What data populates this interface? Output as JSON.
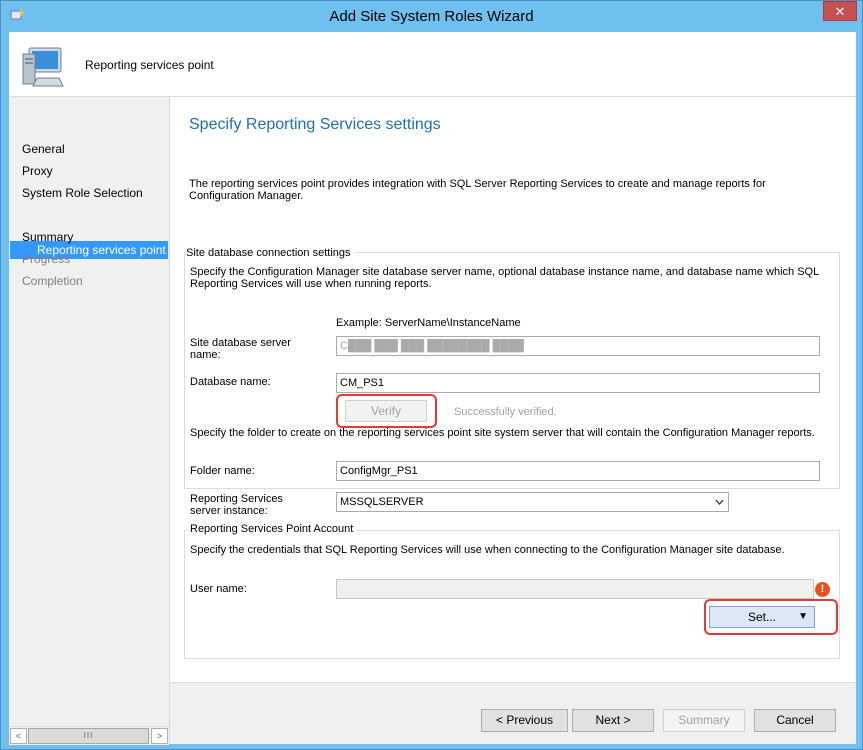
{
  "window": {
    "title": "Add Site System Roles Wizard",
    "close_glyph": "✕"
  },
  "header": {
    "title": "Reporting services point"
  },
  "nav": {
    "items": [
      {
        "label": "General"
      },
      {
        "label": "Proxy"
      },
      {
        "label": "System Role Selection"
      },
      {
        "label": "Reporting services point"
      },
      {
        "label": "Summary"
      },
      {
        "label": "Progress"
      },
      {
        "label": "Completion"
      }
    ],
    "scroll_left": "<",
    "scroll_right": ">",
    "scroll_grip": "III"
  },
  "page": {
    "heading": "Specify Reporting Services settings",
    "intro": "The reporting services point provides integration with SQL Server Reporting Services to create and manage reports for Configuration Manager.",
    "db_group": {
      "title": "Site database connection settings",
      "description": "Specify the Configuration Manager site database server name, optional database instance name, and database name which SQL Reporting Services will use when running reports.",
      "example": "Example: ServerName\\InstanceName",
      "server_label": "Site database server name:",
      "server_value": "C███ ███ ███ ████████ ████",
      "dbname_label": "Database name:",
      "dbname_value": "CM_PS1",
      "verify_label": "Verify",
      "verify_status": "Successfully verified.",
      "folder_desc": "Specify the folder to create on the reporting services point site system server that will contain the Configuration Manager reports.",
      "folder_label": "Folder name:",
      "folder_value": "ConfigMgr_PS1"
    },
    "instance_label": "Reporting Services server instance:",
    "instance_value": "MSSQLSERVER",
    "account_group": {
      "title": "Reporting Services Point Account",
      "description": "Specify the credentials that SQL Reporting Services will use when connecting to the Configuration Manager site database.",
      "username_label": "User name:",
      "username_value": "",
      "error_glyph": "!",
      "set_label": "Set...",
      "set_arrow": "▼"
    }
  },
  "footer": {
    "previous": "< Previous",
    "next": "Next >",
    "summary": "Summary",
    "cancel": "Cancel"
  },
  "colors": {
    "accent": "#1e6fb5",
    "selection": "#3399ff",
    "highlight": "#e03a3a",
    "titlebar": "#6fc0ee"
  }
}
